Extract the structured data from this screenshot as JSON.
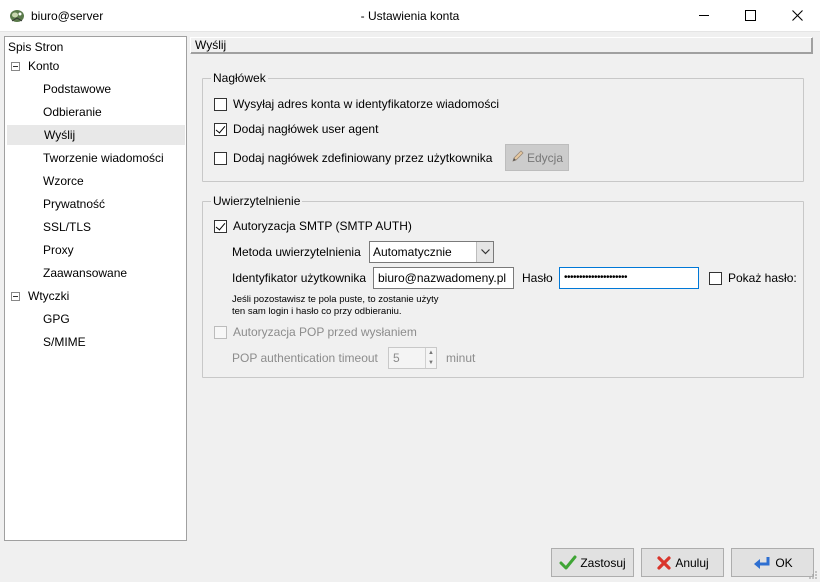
{
  "window": {
    "app_name": "biuro@server",
    "title": "- Ustawienia konta"
  },
  "tree": {
    "title": "Spis Stron",
    "nodes": [
      {
        "label": "Konto",
        "level": 0,
        "expanded": true
      },
      {
        "label": "Podstawowe",
        "level": 1
      },
      {
        "label": "Odbieranie",
        "level": 1
      },
      {
        "label": "Wyślij",
        "level": 1,
        "selected": true
      },
      {
        "label": "Tworzenie wiadomości",
        "level": 1
      },
      {
        "label": "Wzorce",
        "level": 1
      },
      {
        "label": "Prywatność",
        "level": 1
      },
      {
        "label": "SSL/TLS",
        "level": 1
      },
      {
        "label": "Proxy",
        "level": 1
      },
      {
        "label": "Zaawansowane",
        "level": 1
      },
      {
        "label": "Wtyczki",
        "level": 0,
        "expanded": true
      },
      {
        "label": "GPG",
        "level": 1
      },
      {
        "label": "S/MIME",
        "level": 1
      }
    ]
  },
  "page": {
    "header": "Wyślij",
    "headers_group": {
      "title": "Nagłówek",
      "send_account_address": {
        "label": "Wysyłaj adres konta w identyfikatorze wiadomości",
        "checked": false
      },
      "add_user_agent": {
        "label": "Dodaj nagłówek user agent",
        "checked": true
      },
      "add_custom_header": {
        "label": "Dodaj nagłówek zdefiniowany przez użytkownika",
        "checked": false
      },
      "edit_button": "Edycja"
    },
    "auth_group": {
      "title": "Uwierzytelnienie",
      "smtp_auth": {
        "label": "Autoryzacja SMTP (SMTP AUTH)",
        "checked": true
      },
      "method_label": "Metoda uwierzytelnienia",
      "method_value": "Automatycznie",
      "user_id_label": "Identyfikator użytkownika",
      "user_id_value": "biuro@nazwadomeny.pl",
      "password_label": "Hasło",
      "password_value": "•••••••••••••••••••••",
      "show_password": {
        "label": "Pokaż hasło:",
        "checked": false
      },
      "note_line1": "Jeśli pozostawisz te pola puste, to zostanie użyty",
      "note_line2": "ten sam login i hasło co przy odbieraniu.",
      "pop_before_smtp": {
        "label": "Autoryzacja POP przed wysłaniem",
        "checked": false
      },
      "pop_timeout_label": "POP authentication timeout",
      "pop_timeout_value": "5",
      "pop_timeout_unit": "minut"
    }
  },
  "buttons": {
    "apply": "Zastosuj",
    "cancel": "Anuluj",
    "ok": "OK"
  },
  "colors": {
    "accent": "#0078d7",
    "selected_row": "#e8e8e8",
    "apply_icon": "#3fa535",
    "cancel_icon": "#d9342b",
    "ok_icon": "#2e6fd1"
  }
}
